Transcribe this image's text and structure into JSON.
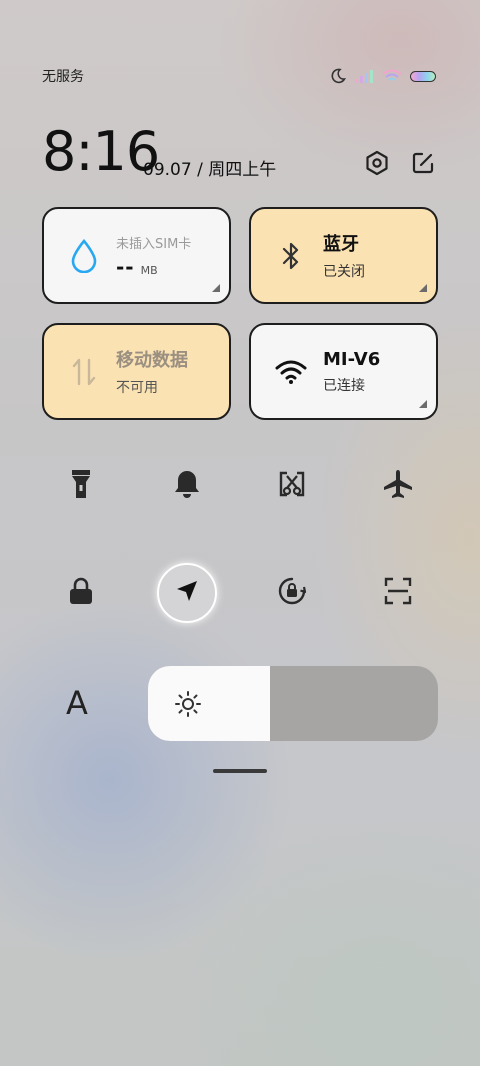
{
  "status_bar": {
    "carrier": "无服务",
    "icons": [
      "moon-icon",
      "signal-icon",
      "wifi-icon",
      "battery-icon"
    ],
    "battery_colors": [
      "#f4a9d0",
      "#b9a4f2",
      "#8fd2ef",
      "#b7eec0"
    ]
  },
  "header": {
    "time": "8:16",
    "date": "09.07 / 周四上午",
    "icons": [
      "settings-icon",
      "edit-icon"
    ]
  },
  "tiles": {
    "sim": {
      "title": "未插入SIM卡",
      "value": "--",
      "unit": "MB",
      "icon": "water-drop-icon",
      "icon_color": "#29a8f2"
    },
    "bluetooth": {
      "title": "蓝牙",
      "subtitle": "已关闭",
      "icon": "bluetooth-icon"
    },
    "mobile_data": {
      "title": "移动数据",
      "subtitle": "不可用",
      "icon": "data-arrows-icon"
    },
    "wifi": {
      "title": "MI-V6",
      "subtitle": "已连接",
      "icon": "wifi-icon"
    }
  },
  "toggles_row1": [
    "flashlight-icon",
    "bell-icon",
    "screenshot-icon",
    "airplane-icon"
  ],
  "toggles_row2": [
    "lock-icon",
    "location-icon",
    "rotation-lock-icon",
    "scan-icon"
  ],
  "brightness": {
    "font_label": "A",
    "level": 0.42,
    "icon": "sun-icon"
  },
  "colors": {
    "tile_yellow": "#fbe2b3",
    "tile_white": "#f6f6f6"
  }
}
